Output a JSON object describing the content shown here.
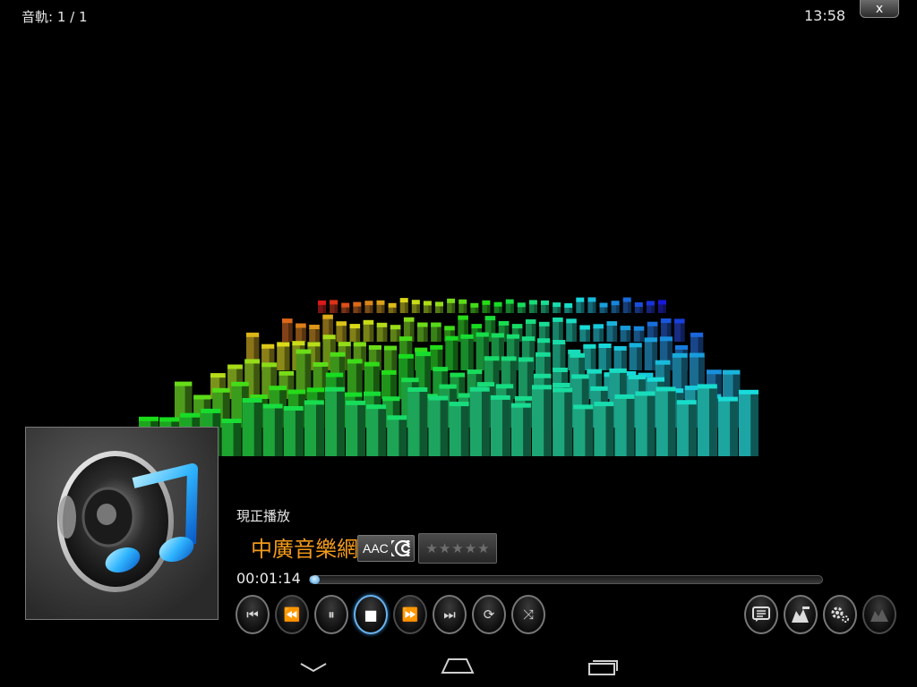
{
  "status_bar": {
    "track_info": "音軌: 1 / 1",
    "time": "13:58",
    "close_label": "x"
  },
  "now_playing": {
    "label": "現正播放",
    "title": "中廣音樂網",
    "format_badge": "AAC",
    "rating": 0,
    "rating_max": 5,
    "elapsed": "00:01:14",
    "progress": 0.01
  },
  "transport_controls": [
    {
      "name": "skip-previous-button",
      "icon": "skip-previous-icon",
      "symbol": "⏮",
      "state": "normal"
    },
    {
      "name": "rewind-button",
      "icon": "rewind-icon",
      "symbol": "⏪",
      "state": "dim"
    },
    {
      "name": "pause-button",
      "icon": "pause-icon",
      "symbol": "⏸",
      "state": "normal"
    },
    {
      "name": "stop-button",
      "icon": "stop-icon",
      "symbol": "■",
      "state": "active"
    },
    {
      "name": "fast-forward-button",
      "icon": "fast-forward-icon",
      "symbol": "⏩",
      "state": "dim"
    },
    {
      "name": "skip-next-button",
      "icon": "skip-next-icon",
      "symbol": "⏭",
      "state": "normal"
    },
    {
      "name": "repeat-button",
      "icon": "repeat-icon",
      "symbol": "⟳",
      "state": "normal"
    },
    {
      "name": "shuffle-button",
      "icon": "shuffle-icon",
      "symbol": "⤨",
      "state": "normal"
    }
  ],
  "right_controls": [
    {
      "name": "playlist-button",
      "icon": "playlist-icon",
      "state": "normal"
    },
    {
      "name": "visualization-button",
      "icon": "visualization-icon",
      "state": "normal"
    },
    {
      "name": "settings-button",
      "icon": "gear-icon",
      "state": "normal"
    },
    {
      "name": "visualization-settings-button",
      "icon": "mountain-icon",
      "state": "dim"
    }
  ],
  "navigation_bar": [
    "back-icon",
    "home-icon",
    "recent-apps-icon"
  ],
  "colors": {
    "title_orange": "#f29a1a",
    "accent_blue": "#3a9ae0"
  }
}
